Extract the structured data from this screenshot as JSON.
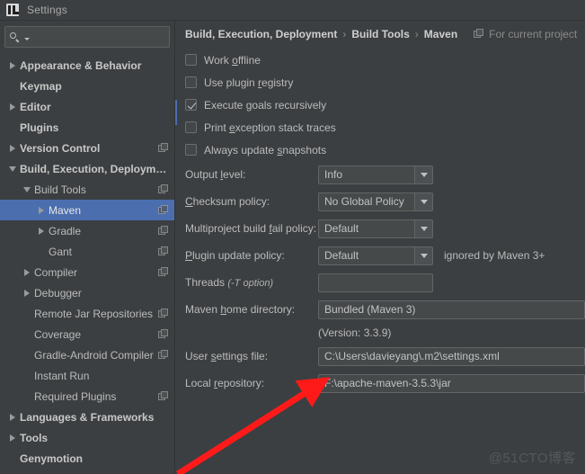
{
  "window": {
    "title": "Settings",
    "icon": "intellij-idea-icon"
  },
  "search": {
    "value": "",
    "placeholder": "",
    "icon": "search-icon"
  },
  "sidebar": {
    "items": [
      {
        "label": "Appearance & Behavior",
        "indent": 0,
        "twisty": "collapsed",
        "bold": true,
        "project_icon": false,
        "selected": false
      },
      {
        "label": "Keymap",
        "indent": 0,
        "twisty": "none",
        "bold": true,
        "project_icon": false,
        "selected": false
      },
      {
        "label": "Editor",
        "indent": 0,
        "twisty": "collapsed",
        "bold": true,
        "project_icon": false,
        "selected": false
      },
      {
        "label": "Plugins",
        "indent": 0,
        "twisty": "none",
        "bold": true,
        "project_icon": false,
        "selected": false
      },
      {
        "label": "Version Control",
        "indent": 0,
        "twisty": "collapsed",
        "bold": true,
        "project_icon": true,
        "selected": false
      },
      {
        "label": "Build, Execution, Deployment",
        "indent": 0,
        "twisty": "expanded",
        "bold": true,
        "project_icon": false,
        "selected": false
      },
      {
        "label": "Build Tools",
        "indent": 1,
        "twisty": "expanded",
        "bold": false,
        "project_icon": true,
        "selected": false
      },
      {
        "label": "Maven",
        "indent": 2,
        "twisty": "collapsed",
        "bold": false,
        "project_icon": true,
        "selected": true
      },
      {
        "label": "Gradle",
        "indent": 2,
        "twisty": "collapsed",
        "bold": false,
        "project_icon": true,
        "selected": false
      },
      {
        "label": "Gant",
        "indent": 2,
        "twisty": "none",
        "bold": false,
        "project_icon": true,
        "selected": false
      },
      {
        "label": "Compiler",
        "indent": 1,
        "twisty": "collapsed",
        "bold": false,
        "project_icon": true,
        "selected": false
      },
      {
        "label": "Debugger",
        "indent": 1,
        "twisty": "collapsed",
        "bold": false,
        "project_icon": false,
        "selected": false
      },
      {
        "label": "Remote Jar Repositories",
        "indent": 1,
        "twisty": "none",
        "bold": false,
        "project_icon": true,
        "selected": false
      },
      {
        "label": "Coverage",
        "indent": 1,
        "twisty": "none",
        "bold": false,
        "project_icon": true,
        "selected": false
      },
      {
        "label": "Gradle-Android Compiler",
        "indent": 1,
        "twisty": "none",
        "bold": false,
        "project_icon": true,
        "selected": false
      },
      {
        "label": "Instant Run",
        "indent": 1,
        "twisty": "none",
        "bold": false,
        "project_icon": false,
        "selected": false
      },
      {
        "label": "Required Plugins",
        "indent": 1,
        "twisty": "none",
        "bold": false,
        "project_icon": true,
        "selected": false
      },
      {
        "label": "Languages & Frameworks",
        "indent": 0,
        "twisty": "collapsed",
        "bold": true,
        "project_icon": false,
        "selected": false
      },
      {
        "label": "Tools",
        "indent": 0,
        "twisty": "collapsed",
        "bold": true,
        "project_icon": false,
        "selected": false
      },
      {
        "label": "Genymotion",
        "indent": 0,
        "twisty": "none",
        "bold": true,
        "project_icon": false,
        "selected": false
      }
    ]
  },
  "breadcrumb": {
    "parts": [
      "Build, Execution, Deployment",
      "Build Tools",
      "Maven"
    ],
    "separator": "›",
    "scope_label": "For current project",
    "scope_icon": "project-scope-icon"
  },
  "main": {
    "checkboxes": [
      {
        "label_before": "Work ",
        "mnemonic": "o",
        "label_after": "ffline",
        "checked": false
      },
      {
        "label_before": "Use plugin ",
        "mnemonic": "r",
        "label_after": "egistry",
        "checked": false
      },
      {
        "label_before": "Execute ",
        "mnemonic": "g",
        "label_after": "oals recursively",
        "checked": true
      },
      {
        "label_before": "Print ",
        "mnemonic": "e",
        "label_after": "xception stack traces",
        "checked": false
      },
      {
        "label_before": "Always update ",
        "mnemonic": "s",
        "label_after": "napshots",
        "checked": false
      }
    ],
    "fields": {
      "output_level": {
        "label_before": "Output ",
        "mnemonic": "l",
        "label_after": "evel:",
        "value": "Info"
      },
      "checksum_policy": {
        "label_before": "",
        "mnemonic": "C",
        "label_after": "hecksum policy:",
        "value": "No Global Policy"
      },
      "multiproject_fail_policy": {
        "label_before": "Multiproject build ",
        "mnemonic": "f",
        "label_after": "ail policy:",
        "value": "Default"
      },
      "plugin_update_policy": {
        "label_before": "",
        "mnemonic": "P",
        "label_after": "lugin update policy:",
        "value": "Default",
        "hint": "ignored by Maven 3+"
      },
      "threads": {
        "label_before": "Threads ",
        "mnemonic": "",
        "label_after": "",
        "option_text": "(-T option)",
        "value": ""
      },
      "maven_home": {
        "label_before": "Maven ",
        "mnemonic": "h",
        "label_after": "ome directory:",
        "value": "Bundled (Maven 3)",
        "version_text": "(Version: 3.3.9)"
      },
      "user_settings_file": {
        "label_before": "User ",
        "mnemonic": "s",
        "label_after": "ettings file:",
        "value": "C:\\Users\\davieyang\\.m2\\settings.xml"
      },
      "local_repository": {
        "label_before": "Local ",
        "mnemonic": "r",
        "label_after": "epository:",
        "value": "F:\\apache-maven-3.5.3\\jar"
      }
    }
  },
  "annotation": {
    "arrow_color": "#ff1a1a",
    "arrow_name": "red-pointer-arrow"
  },
  "watermark": {
    "text": "@51CTO博客"
  },
  "colors": {
    "background": "#3c3f41",
    "selection": "#4b6eaf",
    "field_background": "#45494a",
    "text": "#bbbbbb"
  }
}
